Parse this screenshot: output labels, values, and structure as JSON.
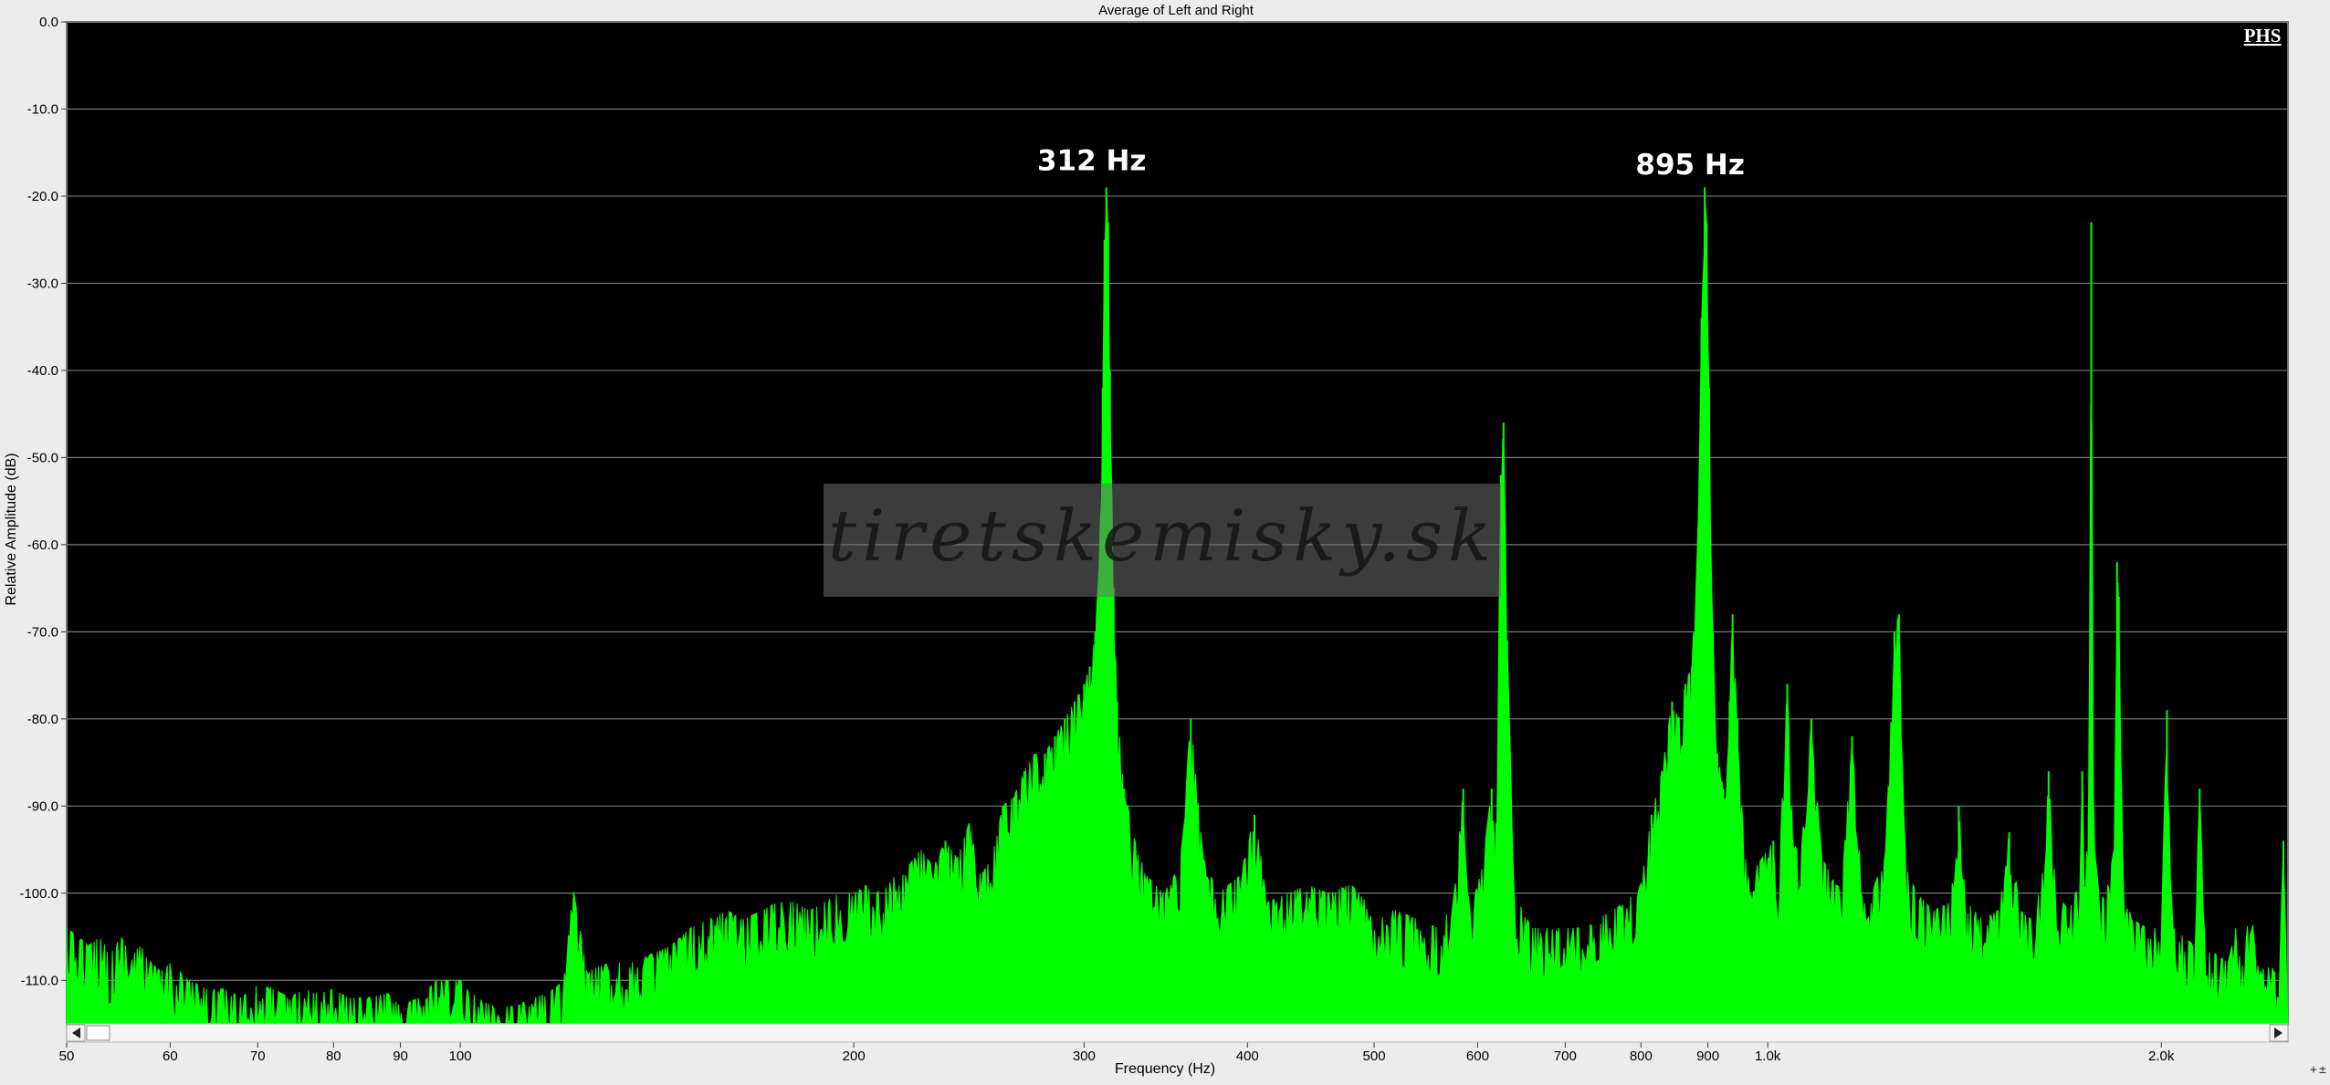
{
  "chart_data": {
    "type": "line",
    "title": "Average of Left and Right",
    "xlabel": "Frequency (Hz)",
    "ylabel": "Relative Amplitude (dB)",
    "x_scale": "log",
    "xlim": [
      50,
      2500
    ],
    "ylim": [
      -115,
      0
    ],
    "grid": true,
    "legend": "none",
    "badge": "PHS",
    "watermark": "tiretskemisky.sk",
    "series_color": "#00ff00",
    "background": "#000000",
    "x_ticks": [
      {
        "value": 50,
        "label": "50"
      },
      {
        "value": 60,
        "label": "60"
      },
      {
        "value": 70,
        "label": "70"
      },
      {
        "value": 80,
        "label": "80"
      },
      {
        "value": 90,
        "label": "90"
      },
      {
        "value": 100,
        "label": "100"
      },
      {
        "value": 200,
        "label": "200"
      },
      {
        "value": 300,
        "label": "300"
      },
      {
        "value": 400,
        "label": "400"
      },
      {
        "value": 500,
        "label": "500"
      },
      {
        "value": 600,
        "label": "600"
      },
      {
        "value": 700,
        "label": "700"
      },
      {
        "value": 800,
        "label": "800"
      },
      {
        "value": 900,
        "label": "900"
      },
      {
        "value": 1000,
        "label": "1.0k"
      },
      {
        "value": 2000,
        "label": "2.0k"
      }
    ],
    "y_ticks": [
      {
        "value": 0,
        "label": "0.0"
      },
      {
        "value": -10,
        "label": "-10.0"
      },
      {
        "value": -20,
        "label": "-20.0"
      },
      {
        "value": -30,
        "label": "-30.0"
      },
      {
        "value": -40,
        "label": "-40.0"
      },
      {
        "value": -50,
        "label": "-50.0"
      },
      {
        "value": -60,
        "label": "-60.0"
      },
      {
        "value": -70,
        "label": "-70.0"
      },
      {
        "value": -80,
        "label": "-80.0"
      },
      {
        "value": -90,
        "label": "-90.0"
      },
      {
        "value": -100,
        "label": "-100.0"
      },
      {
        "value": -110,
        "label": "-110.0"
      }
    ],
    "annotations": [
      {
        "text": "312 Hz",
        "x": 312,
        "y": -17
      },
      {
        "text": "895 Hz",
        "x": 895,
        "y": -17.5
      }
    ],
    "spectrum": [
      [
        50,
        -104
      ],
      [
        51,
        -105
      ],
      [
        52,
        -106
      ],
      [
        53,
        -105
      ],
      [
        54,
        -107
      ],
      [
        55,
        -105
      ],
      [
        56,
        -107
      ],
      [
        57,
        -106
      ],
      [
        58,
        -108
      ],
      [
        59,
        -109
      ],
      [
        60,
        -108
      ],
      [
        62,
        -110
      ],
      [
        64,
        -111
      ],
      [
        66,
        -111
      ],
      [
        68,
        -112
      ],
      [
        70,
        -110.5
      ],
      [
        72,
        -111
      ],
      [
        74,
        -112
      ],
      [
        76,
        -111
      ],
      [
        78,
        -111.5
      ],
      [
        80,
        -111
      ],
      [
        82,
        -112
      ],
      [
        85,
        -112
      ],
      [
        88,
        -111.5
      ],
      [
        90,
        -113
      ],
      [
        93,
        -112
      ],
      [
        96,
        -110
      ],
      [
        100,
        -110
      ],
      [
        103,
        -112
      ],
      [
        106,
        -113
      ],
      [
        110,
        -113
      ],
      [
        114,
        -112
      ],
      [
        118,
        -111
      ],
      [
        120,
        -110
      ],
      [
        122,
        -99.5
      ],
      [
        125,
        -109
      ],
      [
        130,
        -108
      ],
      [
        135,
        -108
      ],
      [
        140,
        -107
      ],
      [
        145,
        -106
      ],
      [
        150,
        -104
      ],
      [
        155,
        -103
      ],
      [
        160,
        -102
      ],
      [
        165,
        -103
      ],
      [
        170,
        -102
      ],
      [
        175,
        -101
      ],
      [
        180,
        -101
      ],
      [
        185,
        -102
      ],
      [
        190,
        -101
      ],
      [
        195,
        -100
      ],
      [
        200,
        -100
      ],
      [
        205,
        -99
      ],
      [
        210,
        -100
      ],
      [
        215,
        -98
      ],
      [
        220,
        -97
      ],
      [
        225,
        -95
      ],
      [
        230,
        -97
      ],
      [
        235,
        -94
      ],
      [
        240,
        -96
      ],
      [
        245,
        -92
      ],
      [
        250,
        -98
      ],
      [
        255,
        -96
      ],
      [
        260,
        -90
      ],
      [
        265,
        -89
      ],
      [
        270,
        -86
      ],
      [
        275,
        -84
      ],
      [
        280,
        -84
      ],
      [
        285,
        -82
      ],
      [
        290,
        -80
      ],
      [
        295,
        -78
      ],
      [
        300,
        -76
      ],
      [
        303,
        -74
      ],
      [
        306,
        -70
      ],
      [
        308,
        -63
      ],
      [
        310,
        -42
      ],
      [
        311,
        -25
      ],
      [
        312,
        -19
      ],
      [
        313,
        -23
      ],
      [
        314,
        -40
      ],
      [
        316,
        -65
      ],
      [
        318,
        -78
      ],
      [
        322,
        -88
      ],
      [
        328,
        -94
      ],
      [
        335,
        -98
      ],
      [
        345,
        -100
      ],
      [
        355,
        -97
      ],
      [
        362,
        -80
      ],
      [
        370,
        -96
      ],
      [
        380,
        -100
      ],
      [
        395,
        -98
      ],
      [
        405,
        -91
      ],
      [
        415,
        -101
      ],
      [
        430,
        -100
      ],
      [
        445,
        -99
      ],
      [
        460,
        -100
      ],
      [
        480,
        -99
      ],
      [
        500,
        -102
      ],
      [
        520,
        -102
      ],
      [
        540,
        -103
      ],
      [
        560,
        -104
      ],
      [
        575,
        -101
      ],
      [
        585,
        -88
      ],
      [
        595,
        -101
      ],
      [
        605,
        -97
      ],
      [
        615,
        -88
      ],
      [
        620,
        -92
      ],
      [
        625,
        -52
      ],
      [
        628,
        -46
      ],
      [
        632,
        -71
      ],
      [
        640,
        -100
      ],
      [
        660,
        -104
      ],
      [
        680,
        -104
      ],
      [
        700,
        -104
      ],
      [
        720,
        -104
      ],
      [
        740,
        -103
      ],
      [
        760,
        -102
      ],
      [
        780,
        -101
      ],
      [
        800,
        -99
      ],
      [
        815,
        -91
      ],
      [
        830,
        -86
      ],
      [
        845,
        -78
      ],
      [
        855,
        -80
      ],
      [
        865,
        -76
      ],
      [
        875,
        -74
      ],
      [
        885,
        -58
      ],
      [
        890,
        -34
      ],
      [
        895,
        -19
      ],
      [
        898,
        -23
      ],
      [
        902,
        -42
      ],
      [
        908,
        -70
      ],
      [
        915,
        -84
      ],
      [
        925,
        -88
      ],
      [
        935,
        -78
      ],
      [
        940,
        -68
      ],
      [
        948,
        -80
      ],
      [
        960,
        -96
      ],
      [
        980,
        -97
      ],
      [
        1000,
        -95
      ],
      [
        1010,
        -94
      ],
      [
        1020,
        -98
      ],
      [
        1035,
        -76
      ],
      [
        1045,
        -94
      ],
      [
        1060,
        -96
      ],
      [
        1080,
        -80
      ],
      [
        1100,
        -96
      ],
      [
        1120,
        -98
      ],
      [
        1140,
        -99
      ],
      [
        1160,
        -82
      ],
      [
        1180,
        -99
      ],
      [
        1200,
        -100
      ],
      [
        1230,
        -96
      ],
      [
        1250,
        -70
      ],
      [
        1260,
        -68
      ],
      [
        1275,
        -97
      ],
      [
        1300,
        -100
      ],
      [
        1340,
        -102
      ],
      [
        1380,
        -101
      ],
      [
        1400,
        -90
      ],
      [
        1420,
        -101
      ],
      [
        1460,
        -103
      ],
      [
        1500,
        -102
      ],
      [
        1530,
        -93
      ],
      [
        1560,
        -102
      ],
      [
        1590,
        -103
      ],
      [
        1620,
        -99
      ],
      [
        1640,
        -86
      ],
      [
        1660,
        -100
      ],
      [
        1700,
        -102
      ],
      [
        1730,
        -99
      ],
      [
        1740,
        -86
      ],
      [
        1750,
        -98
      ],
      [
        1760,
        -91
      ],
      [
        1768,
        -23
      ],
      [
        1775,
        -94
      ],
      [
        1790,
        -99
      ],
      [
        1810,
        -101
      ],
      [
        1840,
        -95
      ],
      [
        1850,
        -62
      ],
      [
        1856,
        -66
      ],
      [
        1870,
        -99
      ],
      [
        1900,
        -103
      ],
      [
        1950,
        -104
      ],
      [
        2000,
        -104
      ],
      [
        2020,
        -79
      ],
      [
        2040,
        -104
      ],
      [
        2080,
        -105
      ],
      [
        2120,
        -106
      ],
      [
        2140,
        -88
      ],
      [
        2160,
        -106
      ],
      [
        2200,
        -107
      ],
      [
        2250,
        -108
      ],
      [
        2280,
        -104
      ],
      [
        2300,
        -108
      ],
      [
        2340,
        -102
      ],
      [
        2380,
        -109
      ],
      [
        2420,
        -108
      ],
      [
        2460,
        -110
      ],
      [
        2480,
        -94
      ],
      [
        2500,
        -112
      ]
    ]
  }
}
